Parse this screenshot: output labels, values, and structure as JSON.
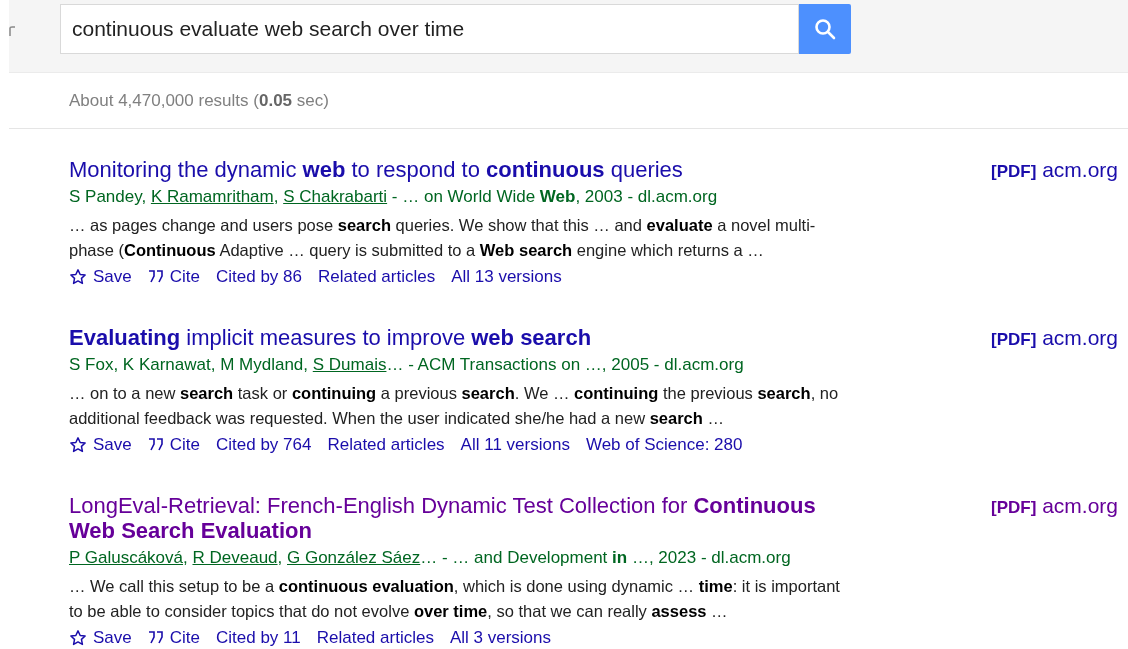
{
  "search": {
    "value": "continuous evaluate web search over time"
  },
  "stats": "About 4,470,000 results (**0.05** sec)",
  "results": [
    {
      "title": "Monitoring the dynamic **web** to respond to **continuous** queries",
      "visited": false,
      "authors": [
        {
          "text": "S Pandey, ",
          "link": false
        },
        {
          "text": "K Ramamritham",
          "link": true
        },
        {
          "text": ", ",
          "link": false
        },
        {
          "text": "S Chakrabarti",
          "link": true
        },
        {
          "text": " - … on World Wide **Web**, 2003 - dl.acm.org",
          "link": false
        }
      ],
      "snippet": "… as pages change and users pose **search** queries. We show that this … and **evaluate** a novel multi-phase (**Continuous** Adaptive … query is submitted to a **Web search** engine which returns a …",
      "actions": [
        {
          "kind": "save",
          "label": "Save"
        },
        {
          "kind": "cite",
          "label": "Cite"
        },
        {
          "kind": "link",
          "label": "Cited by 86"
        },
        {
          "kind": "link",
          "label": "Related articles"
        },
        {
          "kind": "link",
          "label": "All 13 versions"
        }
      ],
      "pdf": {
        "tag": "[PDF]",
        "host": "acm.org"
      }
    },
    {
      "title": "**Evaluating** implicit measures to improve **web search**",
      "visited": false,
      "authors": [
        {
          "text": "S Fox, K Karnawat, M Mydland, ",
          "link": false
        },
        {
          "text": "S Dumais",
          "link": true
        },
        {
          "text": "… - ACM Transactions on …, 2005 - dl.acm.org",
          "link": false
        }
      ],
      "snippet": "… on to a new **search** task or **continuing** a previous **search**. We … **continuing** the previous **search**, no additional feedback was requested. When the user indicated she/he had a new **search** …",
      "actions": [
        {
          "kind": "save",
          "label": "Save"
        },
        {
          "kind": "cite",
          "label": "Cite"
        },
        {
          "kind": "link",
          "label": "Cited by 764"
        },
        {
          "kind": "link",
          "label": "Related articles"
        },
        {
          "kind": "link",
          "label": "All 11 versions"
        },
        {
          "kind": "link",
          "label": "Web of Science: 280"
        }
      ],
      "pdf": {
        "tag": "[PDF]",
        "host": "acm.org"
      }
    },
    {
      "title": "LongEval-Retrieval: French-English Dynamic Test Collection for **Continuous Web Search Evaluation**",
      "visited": true,
      "authors": [
        {
          "text": "P Galuscáková",
          "link": true
        },
        {
          "text": ", ",
          "link": false
        },
        {
          "text": "R Deveaud",
          "link": true
        },
        {
          "text": ", ",
          "link": false
        },
        {
          "text": "G González Sáez",
          "link": true
        },
        {
          "text": "… - … and Development **in** …, 2023 - dl.acm.org",
          "link": false
        }
      ],
      "snippet": "… We call this setup to be a **continuous evaluation**, which is done using dynamic … **time**: it is important to be able to consider topics that do not evolve **over time**, so that we can really **assess** …",
      "actions": [
        {
          "kind": "save",
          "label": "Save"
        },
        {
          "kind": "cite",
          "label": "Cite"
        },
        {
          "kind": "link",
          "label": "Cited by 11"
        },
        {
          "kind": "link",
          "label": "Related articles"
        },
        {
          "kind": "link",
          "label": "All 3 versions"
        }
      ],
      "pdf": {
        "tag": "[PDF]",
        "host": "acm.org"
      }
    }
  ]
}
